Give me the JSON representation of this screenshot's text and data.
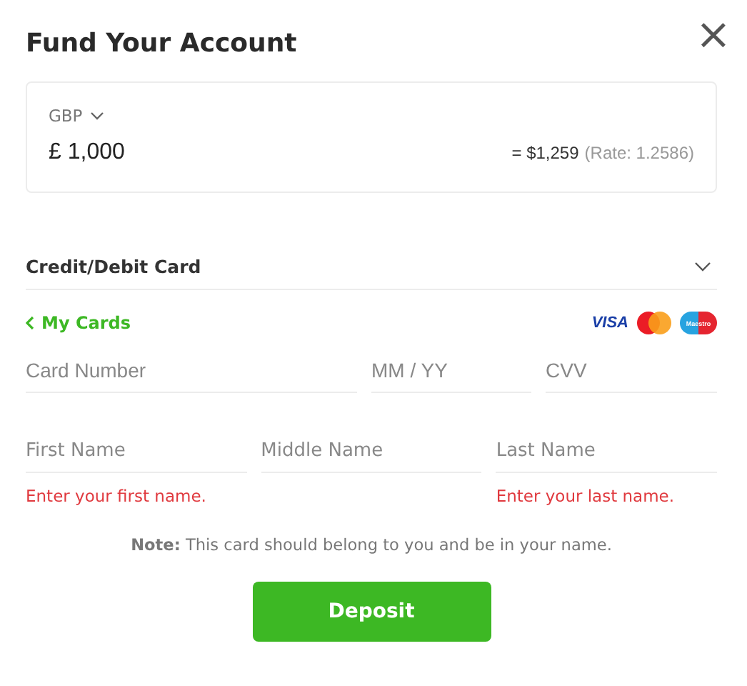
{
  "dialog": {
    "title": "Fund Your Account",
    "close_label": "×"
  },
  "amount": {
    "currency": "GBP",
    "value": "£ 1,000",
    "converted": "= $1,259",
    "rate": "(Rate: 1.2586)"
  },
  "payment_method": {
    "label": "Credit/Debit Card",
    "expanded": true
  },
  "my_cards_link": "My Cards",
  "card_logos": [
    {
      "kind": "visa",
      "text": "VISA"
    },
    {
      "kind": "mastercard"
    },
    {
      "kind": "maestro",
      "text": "Maestro"
    }
  ],
  "card_fields": [
    {
      "placeholder": "Card Number"
    },
    {
      "placeholder": "MM / YY"
    },
    {
      "placeholder": "CVV"
    }
  ],
  "name_fields": [
    {
      "placeholder": "First Name",
      "error": "Enter your first name."
    },
    {
      "placeholder": "Middle Name"
    },
    {
      "placeholder": "Last Name",
      "error": "Enter your last name."
    }
  ],
  "note": "**Note:** This card should belong to you and be in your name.",
  "buttons": [
    "Deposit"
  ]
}
